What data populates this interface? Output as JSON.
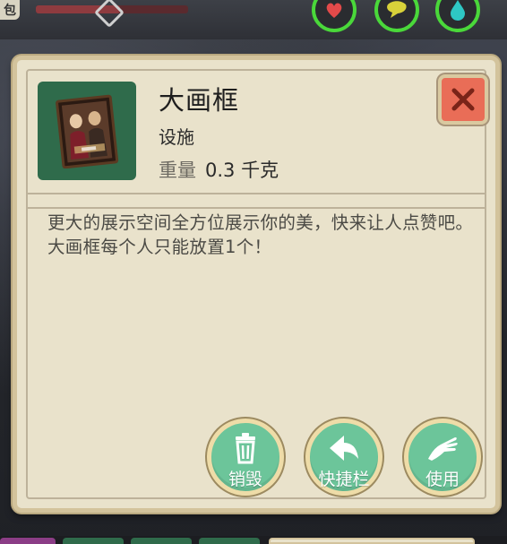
{
  "hud": {
    "tag_text": "包",
    "hp_fraction": 0.55,
    "status_icons": [
      {
        "name": "heart-icon",
        "color": "#e24a4a"
      },
      {
        "name": "chat-bubble-icon",
        "color": "#d8d23a"
      },
      {
        "name": "water-drop-icon",
        "color": "#2ec7c4"
      }
    ]
  },
  "item": {
    "name": "大画框",
    "category": "设施",
    "weight_label": "重量",
    "weight_value": "0.3 千克",
    "thumbnail_icon": "picture-frame-icon",
    "description": "更大的展示空间全方位展示你的美，快来让人点赞吧。大画框每个人只能放置1个！"
  },
  "close_icon": "close-x-icon",
  "actions": [
    {
      "label": "销毁",
      "icon": "trash-icon"
    },
    {
      "label": "快捷栏",
      "icon": "shortcut-arrow-icon"
    },
    {
      "label": "使用",
      "icon": "hand-use-icon"
    }
  ],
  "colors": {
    "panel_bg": "#e9e2cb",
    "action_green": "#6cc59a",
    "close_red": "#e96d57",
    "status_ring": "#4ad83a"
  }
}
